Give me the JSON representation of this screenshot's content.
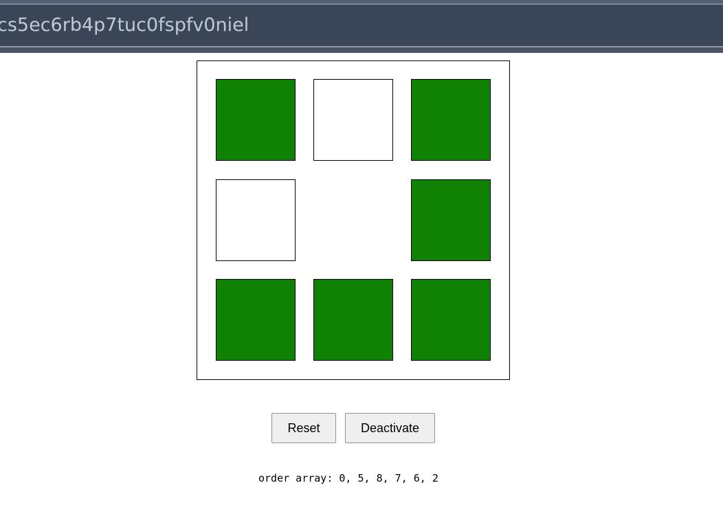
{
  "window": {
    "title": "cs5ec6rb4p7tuc0fspfv0niel"
  },
  "grid": {
    "cells": [
      {
        "index": 0,
        "state": "on"
      },
      {
        "index": 1,
        "state": "off"
      },
      {
        "index": 2,
        "state": "on"
      },
      {
        "index": 3,
        "state": "off"
      },
      {
        "index": 4,
        "state": "empty"
      },
      {
        "index": 5,
        "state": "on"
      },
      {
        "index": 6,
        "state": "on"
      },
      {
        "index": 7,
        "state": "on"
      },
      {
        "index": 8,
        "state": "on"
      }
    ],
    "active_color": "#0f8204",
    "inactive_color": "#ffffff"
  },
  "controls": {
    "reset_label": "Reset",
    "deactivate_label": "Deactivate"
  },
  "status": {
    "order_text": "order array: 0, 5, 8, 7, 6, 2"
  }
}
